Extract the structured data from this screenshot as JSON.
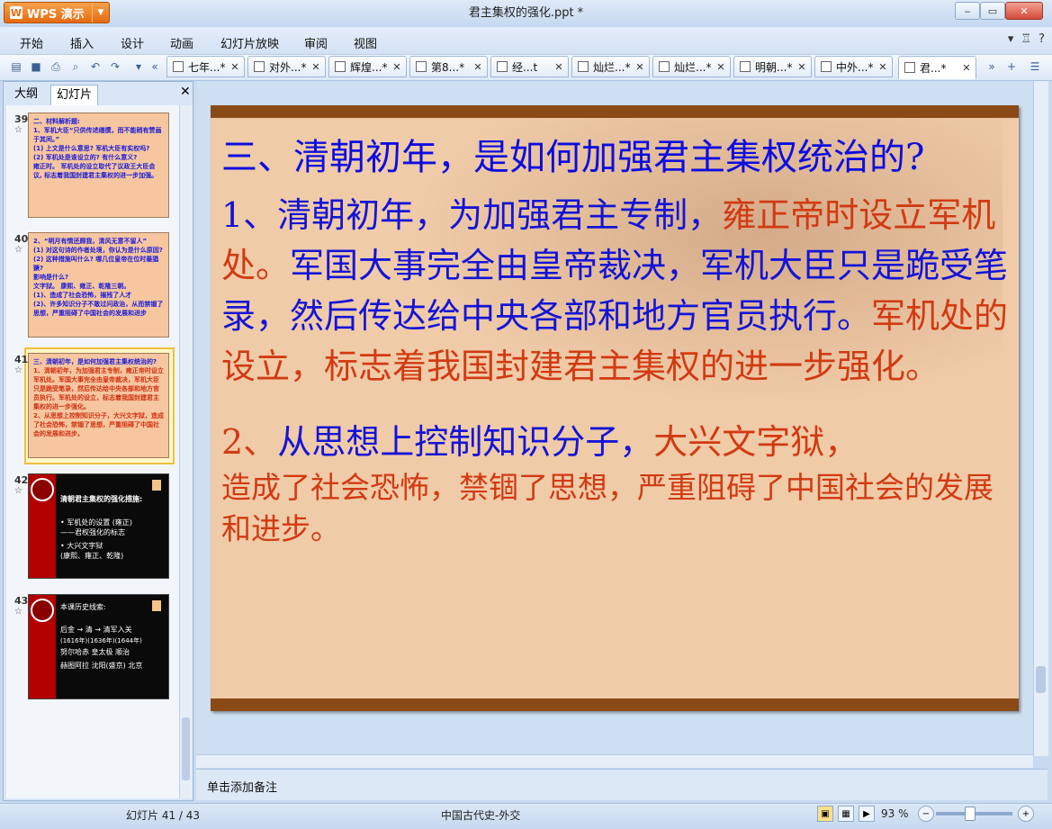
{
  "window": {
    "app_label": "WPS 演示",
    "doc_title": "君主集权的强化.ppt *"
  },
  "menu": [
    "开始",
    "插入",
    "设计",
    "动画",
    "幻灯片放映",
    "审阅",
    "视图"
  ],
  "tabs": [
    {
      "label": "七年...*"
    },
    {
      "label": "对外...*"
    },
    {
      "label": "辉煌...*"
    },
    {
      "label": "第8...*"
    },
    {
      "label": "经...t"
    },
    {
      "label": "灿烂...*"
    },
    {
      "label": "灿烂...*"
    },
    {
      "label": "明朝...*"
    },
    {
      "label": "中外...*"
    },
    {
      "label": "君...*"
    }
  ],
  "panel": {
    "tab_outline": "大纲",
    "tab_slides": "幻灯片"
  },
  "thumbnails": [
    {
      "num": "39",
      "lines": [
        "二、材料解析题:",
        "1、军机大臣“只供传述缮撰，而不能稍有赞画于其间。”",
        "(1) 上文是什么意思? 军机大臣有实权吗?",
        "(2) 军机处是谁设立的? 有什么意义?",
        "雍正时。 军机处的设立取代了议政王大臣会议, 标志着我国封建君主集权的进一步加强。"
      ]
    },
    {
      "num": "40",
      "lines": [
        "2、“明月有情还顾我，清风无意不留人”",
        "(1) 对这句诗的作者处境，你认为是什么原因?",
        "(2) 这种措施叫什么? 哪几位皇帝在位时最猖獗?",
        "影响是什么?",
        "文字狱。 康熙、雍正、乾隆三朝。",
        "(1)、造成了社会恐怖，摧残了人才",
        "(2)、许多知识分子不敢过问政治，从而禁锢了思想，严重阻碍了中国社会的发展和进步"
      ]
    },
    {
      "num": "41",
      "lines": [
        "三、清朝初年，是如何加强君主集权统治的?",
        "1、清朝初年，为加强君主专制，雍正帝时设立军机处。军国大事完全由皇帝裁决，军机大臣只是跪受笔录，然后传达给中央各部和地方官员执行。军机处的设立，标志着我国封建君主集权的进一步强化。",
        "2、从思想上控制知识分子，大兴文字狱，造成了社会恐怖，禁锢了思想，严重阻碍了中国社会的发展和进步。"
      ]
    },
    {
      "num": "42",
      "lines": [
        "清朝君主集权的强化措施:",
        "• 军机处的设置 (雍正)",
        "——君权强化的标志",
        "• 大兴文字狱",
        "(康熙、雍正、乾隆)"
      ]
    },
    {
      "num": "43",
      "lines": [
        "本课历史线索:",
        "后金 → 清 → 清军入关",
        "(1616年)(1636年)(1644年)",
        "努尔哈赤 皇太极 顺治",
        "赫图阿拉 沈阳(盛京) 北京"
      ]
    }
  ],
  "slide": {
    "heading": "三、清朝初年，是如何加强君主集权统治的?",
    "p1_blue_a": "1、清朝初年，为加强君主专制，",
    "p1_red_a": "雍正帝时设立军机处。",
    "p1_blue_b": "军国大事完全由皇帝裁决，军机大臣只是跪受笔录，然后传达给中央各部和地方官员执行。",
    "p1_red_b": "军机处的设立，标志着我国封建君主集权的进一步强化。",
    "p2_red_a": "2、",
    "p2_blue": "从思想上控制知识分子，",
    "p2_red_b": "大兴文字狱，",
    "p2_red_c": "造成了社会恐怖，禁锢了思想，严重阻碍了中国社会的发展和进步。"
  },
  "notes_placeholder": "单击添加备注",
  "status": {
    "slide_counter": "幻灯片 41 / 43",
    "template": "中国古代史-外交",
    "zoom": "93 %"
  }
}
